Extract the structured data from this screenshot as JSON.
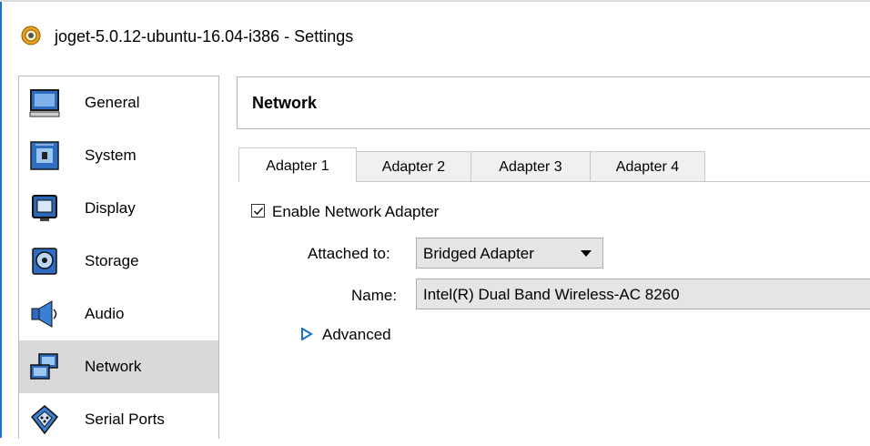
{
  "window": {
    "title": "joget-5.0.12-ubuntu-16.04-i386 - Settings",
    "icon": "gear-icon"
  },
  "sidebar": {
    "items": [
      {
        "label": "General",
        "icon": "general-monitor-icon",
        "selected": false
      },
      {
        "label": "System",
        "icon": "system-chip-icon",
        "selected": false
      },
      {
        "label": "Display",
        "icon": "display-monitor-icon",
        "selected": false
      },
      {
        "label": "Storage",
        "icon": "storage-disk-icon",
        "selected": false
      },
      {
        "label": "Audio",
        "icon": "audio-speaker-icon",
        "selected": false
      },
      {
        "label": "Network",
        "icon": "network-icon",
        "selected": true
      },
      {
        "label": "Serial Ports",
        "icon": "serial-port-icon",
        "selected": false
      }
    ]
  },
  "main": {
    "section_title": "Network",
    "tabs": [
      {
        "label": "Adapter 1",
        "active": true
      },
      {
        "label": "Adapter 2",
        "active": false
      },
      {
        "label": "Adapter 3",
        "active": false
      },
      {
        "label": "Adapter 4",
        "active": false
      }
    ],
    "enable_adapter": {
      "label": "Enable Network Adapter",
      "checked": true
    },
    "attached_to": {
      "label": "Attached to:",
      "value": "Bridged Adapter"
    },
    "name": {
      "label": "Name:",
      "value": "Intel(R) Dual Band Wireless-AC 8260"
    },
    "advanced": {
      "label": "Advanced",
      "expanded": false
    }
  },
  "colors": {
    "selection_background": "#d9d9d9",
    "accent_blue": "#1a73c7",
    "field_background": "#e5e5e5"
  }
}
